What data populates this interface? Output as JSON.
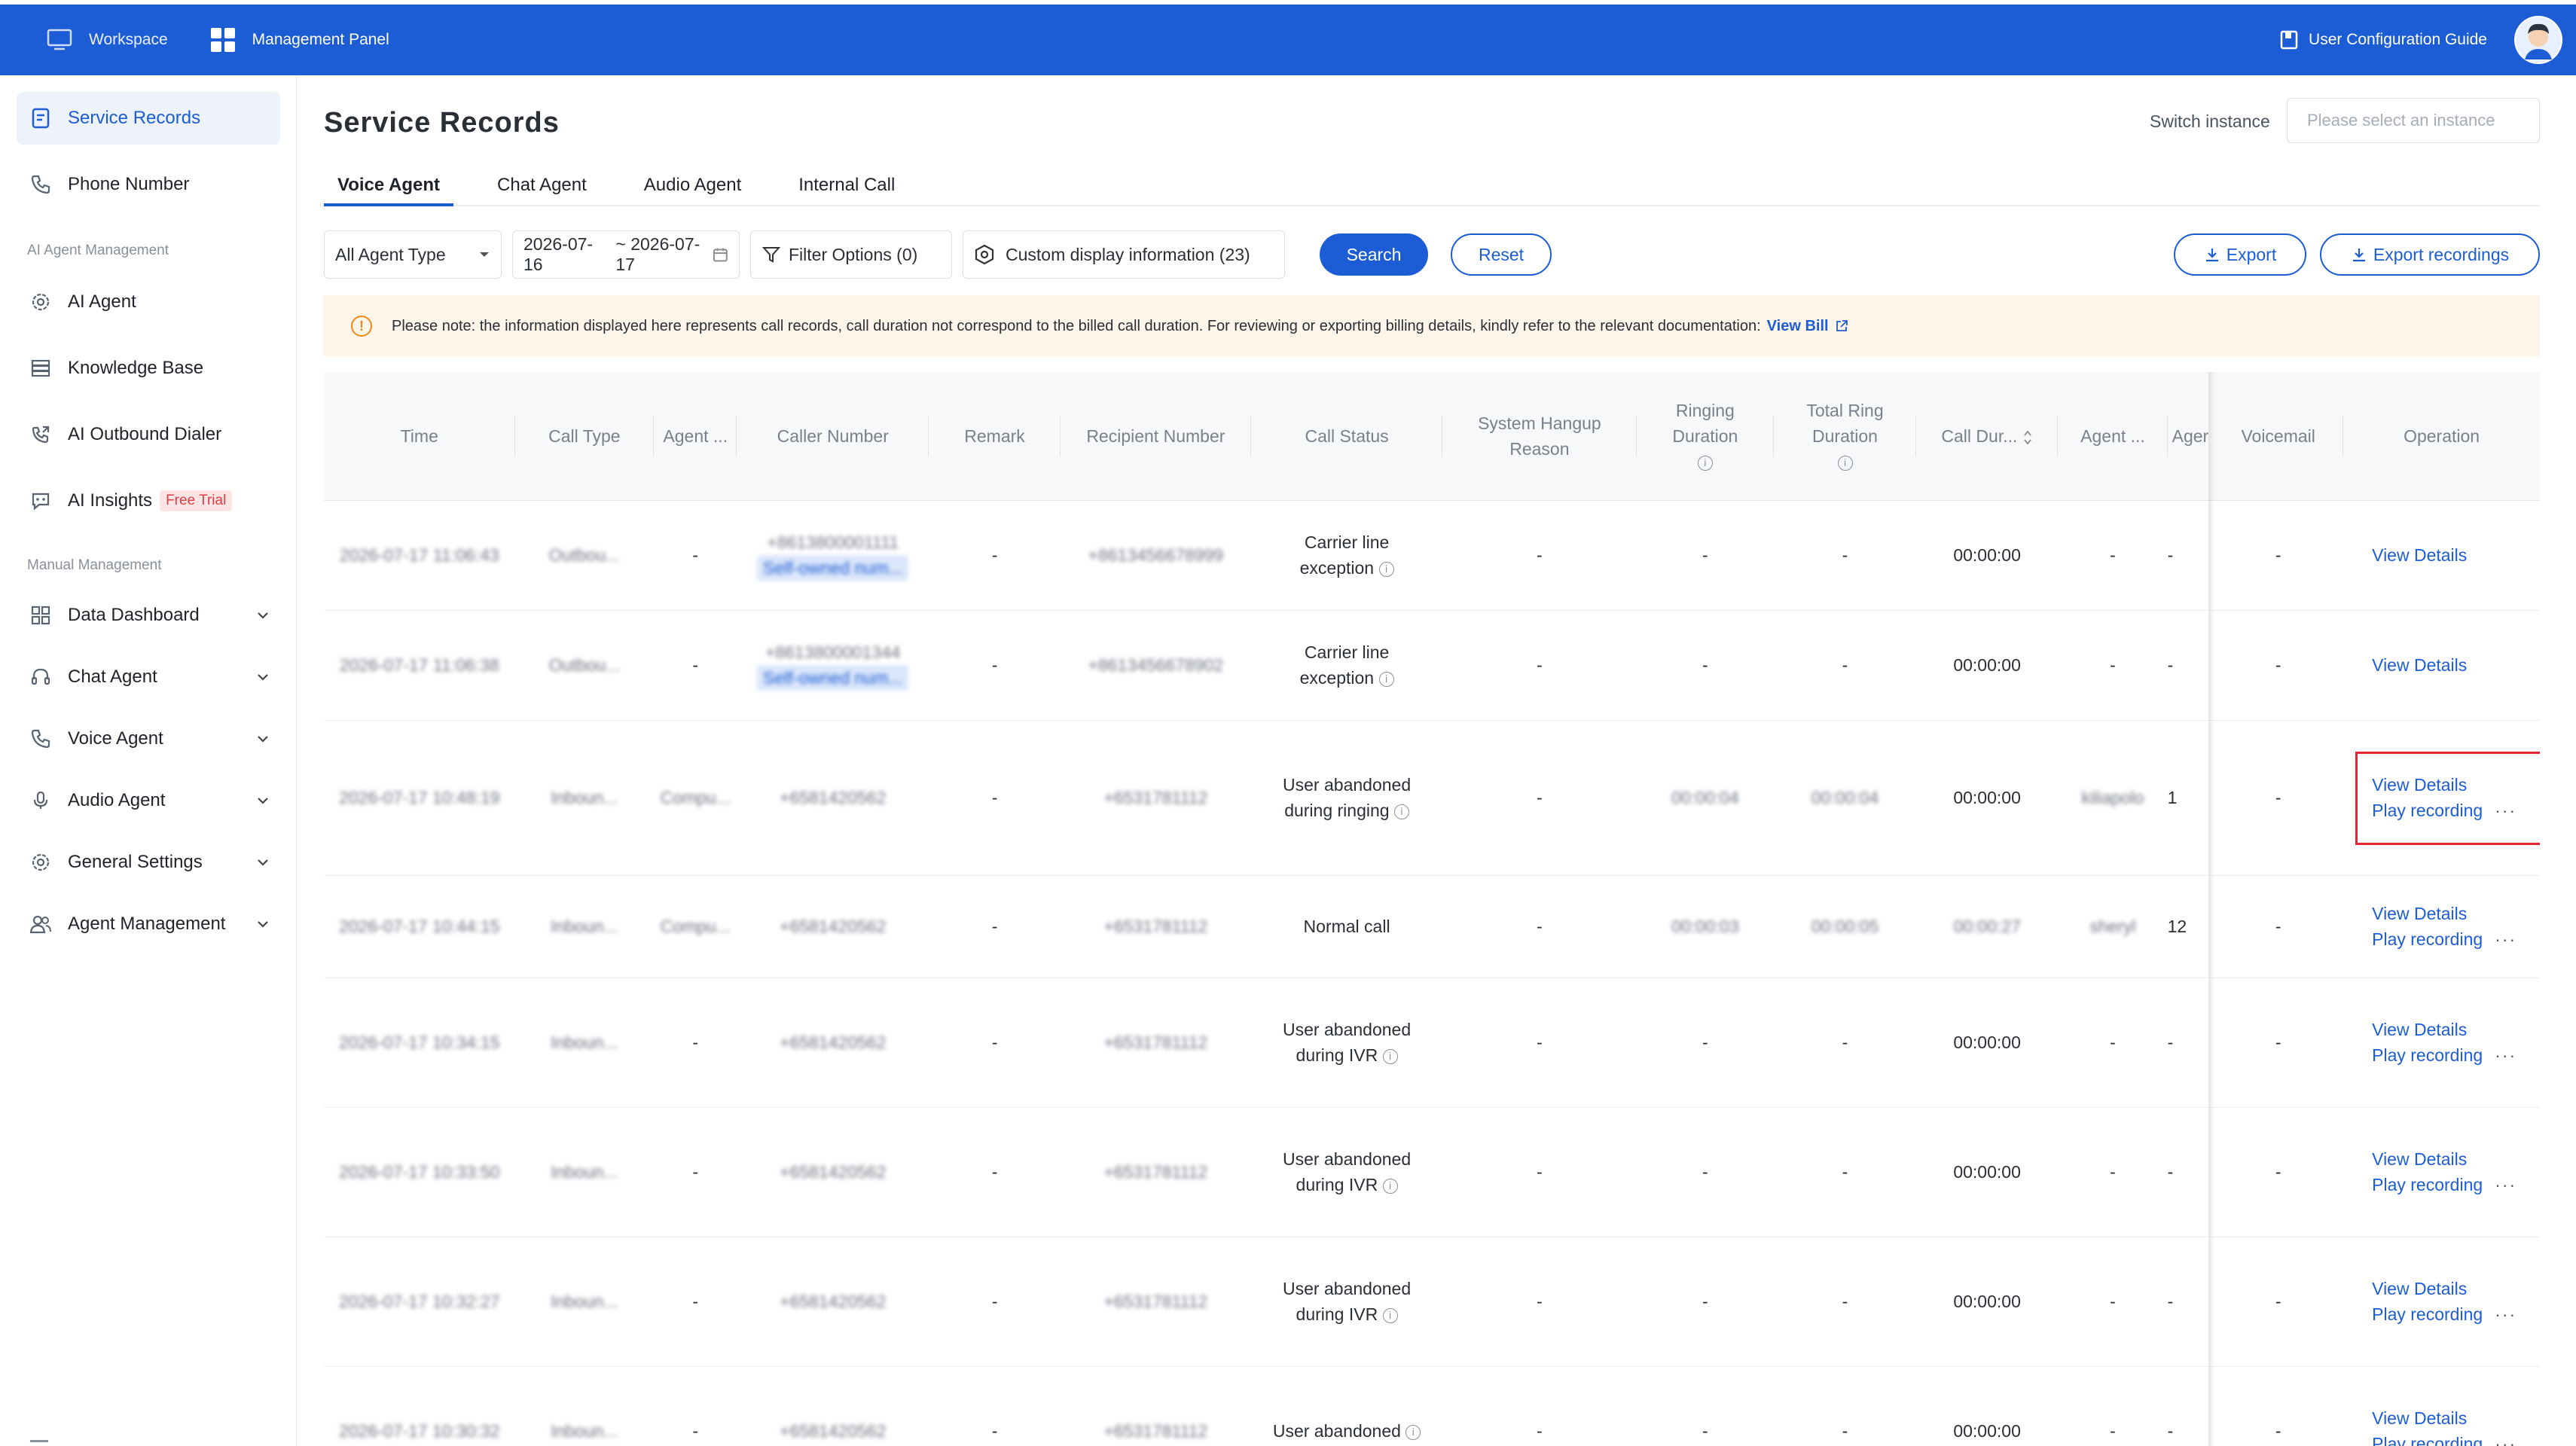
{
  "topbar": {
    "workspace": "Workspace",
    "management_panel": "Management Panel",
    "guide": "User Configuration Guide"
  },
  "sidebar": {
    "items_top": [
      {
        "label": "Service Records",
        "icon": "document-icon"
      },
      {
        "label": "Phone Number",
        "icon": "phone-icon"
      }
    ],
    "section_ai": "AI Agent Management",
    "items_ai": [
      {
        "label": "AI Agent",
        "icon": "gear-icon"
      },
      {
        "label": "Knowledge Base",
        "icon": "database-icon"
      },
      {
        "label": "AI Outbound Dialer",
        "icon": "outbound-call-icon"
      },
      {
        "label": "AI Insights",
        "icon": "chat-bot-icon",
        "badge": "Free Trial"
      }
    ],
    "section_manual": "Manual Management",
    "items_manual": [
      {
        "label": "Data Dashboard",
        "icon": "dashboard-icon"
      },
      {
        "label": "Chat Agent",
        "icon": "headset-icon"
      },
      {
        "label": "Voice Agent",
        "icon": "phone-icon"
      },
      {
        "label": "Audio Agent",
        "icon": "microphone-icon"
      },
      {
        "label": "General Settings",
        "icon": "gear-icon"
      },
      {
        "label": "Agent Management",
        "icon": "users-icon"
      }
    ]
  },
  "page": {
    "title": "Service Records",
    "switch_label": "Switch instance",
    "instance_placeholder": "Please select an instance"
  },
  "tabs": [
    "Voice Agent",
    "Chat Agent",
    "Audio Agent",
    "Internal Call"
  ],
  "toolbar": {
    "agent_type": "All Agent Type",
    "date_start": "2026-07-16",
    "date_end": "~ 2026-07-17",
    "filter": "Filter Options (0)",
    "custom_display": "Custom display information (23)",
    "search": "Search",
    "reset": "Reset",
    "export": "Export",
    "export_recordings": "Export recordings"
  },
  "notice": {
    "text": "Please note: the information displayed here represents call records, call duration not correspond to the billed call duration. For reviewing or exporting billing details, kindly refer to the relevant documentation:",
    "link": "View Bill"
  },
  "table": {
    "headers": [
      "Time",
      "Call Type",
      "Agent ...",
      "Caller Number",
      "Remark",
      "Recipient Number",
      "Call Status",
      "System Hangup Reason",
      "Ringing Duration",
      "Total Ring Duration",
      "Call Dur...",
      "Agent ...",
      "Ager",
      "Voicemail",
      "Operation"
    ],
    "view_details": "View Details",
    "play_recording": "Play recording",
    "more": "···",
    "rows": [
      {
        "time": "2026-07-17 11:06:43",
        "type": "Outbou...",
        "agent": "-",
        "caller": "+8613800001111",
        "caller_tag": "Self-owned num...",
        "remark": "-",
        "recipient": "+8613456678999",
        "status": "Carrier line exception",
        "hangup": "-",
        "ring": "-",
        "total_ring": "-",
        "duration": "00:00:00",
        "agent2": "-",
        "ager": "-",
        "voicemail": "-",
        "play": false
      },
      {
        "time": "2026-07-17 11:06:38",
        "type": "Outbou...",
        "agent": "-",
        "caller": "+8613800001344",
        "caller_tag": "Self-owned num...",
        "remark": "-",
        "recipient": "+8613456678902",
        "status": "Carrier line exception",
        "hangup": "-",
        "ring": "-",
        "total_ring": "-",
        "duration": "00:00:00",
        "agent2": "-",
        "ager": "-",
        "voicemail": "-",
        "play": false
      },
      {
        "time": "2026-07-17 10:48:19",
        "type": "Inboun...",
        "agent": "Compu...",
        "caller": "+6581420562",
        "caller_tag": "",
        "remark": "-",
        "recipient": "+6531781112",
        "status": "User abandoned during ringing",
        "hangup": "-",
        "ring": "00:00:04",
        "total_ring": "00:00:04",
        "duration": "00:00:00",
        "agent2": "kiliapolo",
        "ager": "1",
        "voicemail": "-",
        "play": true
      },
      {
        "time": "2026-07-17 10:44:15",
        "type": "Inboun...",
        "agent": "Compu...",
        "caller": "+6581420562",
        "caller_tag": "",
        "remark": "-",
        "recipient": "+6531781112",
        "status": "Normal call",
        "hangup": "-",
        "ring": "00:00:03",
        "total_ring": "00:00:05",
        "duration": "00:00:27",
        "agent2": "sheryl",
        "ager": "12",
        "voicemail": "-",
        "play": true
      },
      {
        "time": "2026-07-17 10:34:15",
        "type": "Inboun...",
        "agent": "-",
        "caller": "+6581420562",
        "caller_tag": "",
        "remark": "-",
        "recipient": "+6531781112",
        "status": "User abandoned during IVR",
        "hangup": "-",
        "ring": "-",
        "total_ring": "-",
        "duration": "00:00:00",
        "agent2": "-",
        "ager": "-",
        "voicemail": "-",
        "play": true
      },
      {
        "time": "2026-07-17 10:33:50",
        "type": "Inboun...",
        "agent": "-",
        "caller": "+6581420562",
        "caller_tag": "",
        "remark": "-",
        "recipient": "+6531781112",
        "status": "User abandoned during IVR",
        "hangup": "-",
        "ring": "-",
        "total_ring": "-",
        "duration": "00:00:00",
        "agent2": "-",
        "ager": "-",
        "voicemail": "-",
        "play": true
      },
      {
        "time": "2026-07-17 10:32:27",
        "type": "Inboun...",
        "agent": "-",
        "caller": "+6581420562",
        "caller_tag": "",
        "remark": "-",
        "recipient": "+6531781112",
        "status": "User abandoned during IVR",
        "hangup": "-",
        "ring": "-",
        "total_ring": "-",
        "duration": "00:00:00",
        "agent2": "-",
        "ager": "-",
        "voicemail": "-",
        "play": true
      },
      {
        "time": "2026-07-17 10:30:32",
        "type": "Inboun...",
        "agent": "-",
        "caller": "+6581420562",
        "caller_tag": "",
        "remark": "-",
        "recipient": "+6531781112",
        "status": "User abandoned",
        "hangup": "-",
        "ring": "-",
        "total_ring": "-",
        "duration": "00:00:00",
        "agent2": "-",
        "ager": "-",
        "voicemail": "-",
        "play": true
      }
    ]
  },
  "colors": {
    "primary": "#1c5dd6",
    "notice_bg": "#fdf5ea",
    "warning": "#ef8a15",
    "highlight": "#e0262f",
    "badge_bg": "#fde5e6",
    "badge_text": "#e23c44"
  }
}
